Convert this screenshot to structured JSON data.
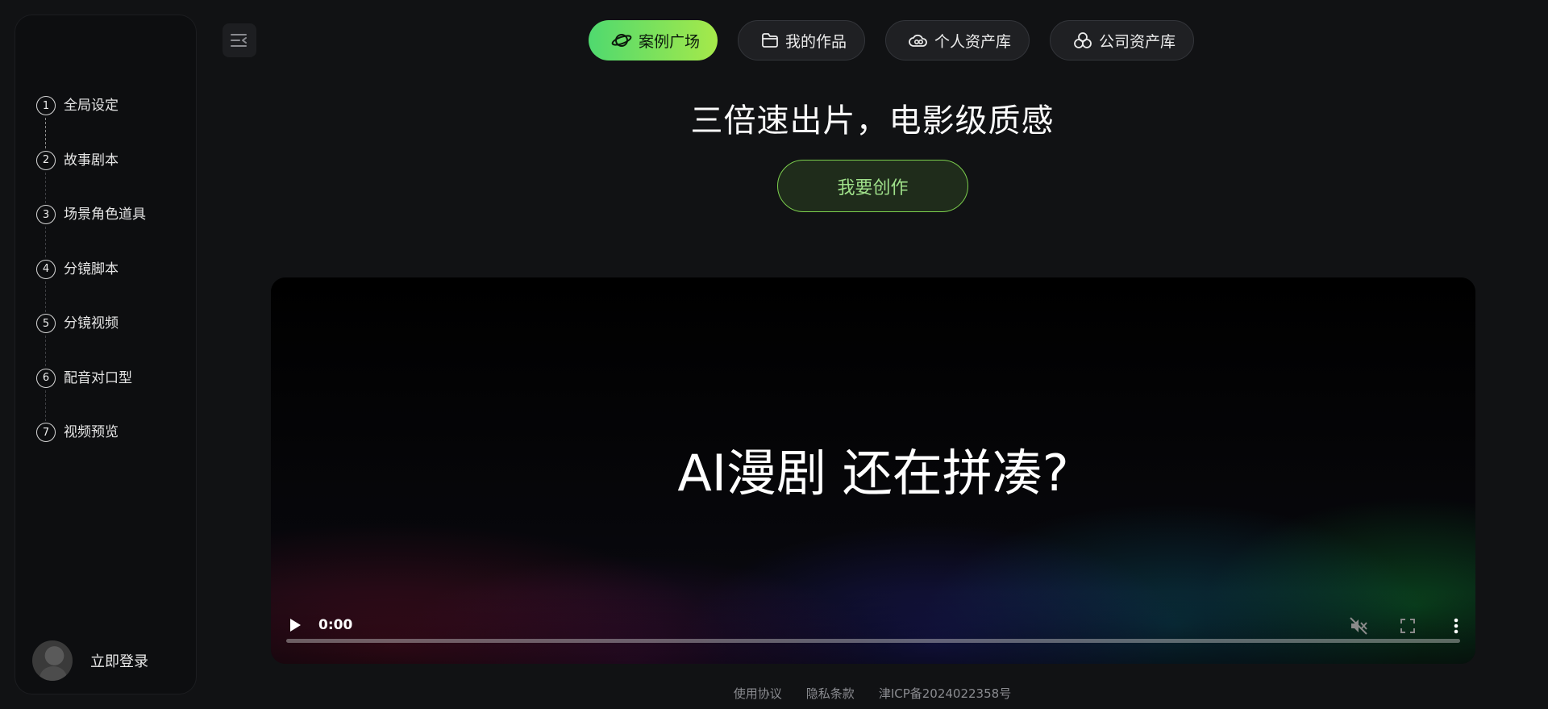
{
  "sidebar": {
    "steps": [
      {
        "num": "1",
        "label": "全局设定"
      },
      {
        "num": "2",
        "label": "故事剧本"
      },
      {
        "num": "3",
        "label": "场景角色道具"
      },
      {
        "num": "4",
        "label": "分镜脚本"
      },
      {
        "num": "5",
        "label": "分镜视频"
      },
      {
        "num": "6",
        "label": "配音对口型"
      },
      {
        "num": "7",
        "label": "视频预览"
      }
    ],
    "login_label": "立即登录"
  },
  "nav": {
    "items": [
      {
        "label": "案例广场",
        "icon": "planet-icon",
        "active": true
      },
      {
        "label": "我的作品",
        "icon": "folder-icon",
        "active": false
      },
      {
        "label": "个人资产库",
        "icon": "cloud-asset-icon",
        "active": false
      },
      {
        "label": "公司资产库",
        "icon": "cluster-icon",
        "active": false
      }
    ]
  },
  "hero": {
    "title": "三倍速出片，电影级质感",
    "cta_label": "我要创作"
  },
  "video": {
    "caption": "AI漫剧 还在拼凑?",
    "current_time": "0:00",
    "progress": 0,
    "muted": true
  },
  "footer": {
    "terms": "使用协议",
    "privacy": "隐私条款",
    "icp": "津ICP备2024022358号"
  },
  "colors": {
    "background": "#111214",
    "accent_start": "#4fd96f",
    "accent_end": "#a6e94a",
    "cta_border": "#7ccf4d"
  }
}
